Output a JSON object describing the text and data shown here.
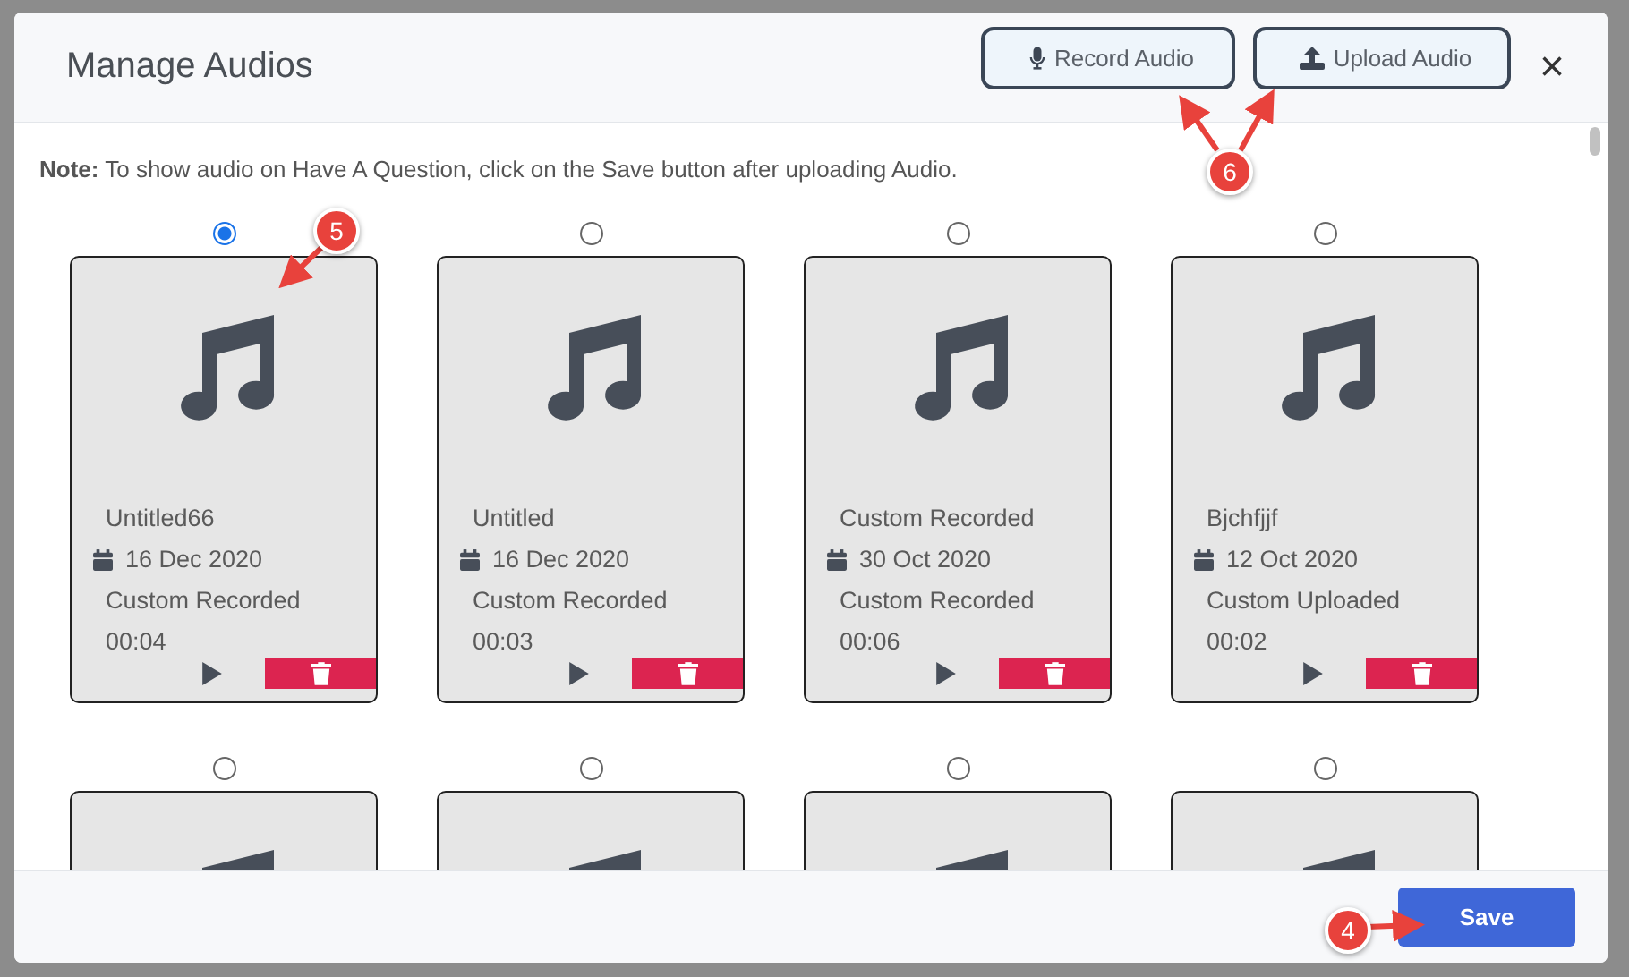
{
  "modal": {
    "title": "Manage Audios",
    "buttons": [
      {
        "kind": "record",
        "label": "Record Audio"
      },
      {
        "kind": "upload",
        "label": "Upload Audio"
      }
    ],
    "close": "×"
  },
  "note": {
    "label": "Note:",
    "text": "To show audio on Have A Question, click on the Save button after uploading Audio."
  },
  "cards": [
    {
      "selected": true,
      "name": "Untitled66",
      "date": "16 Dec 2020",
      "type": "Custom Recorded",
      "duration": "00:04"
    },
    {
      "selected": false,
      "name": "Untitled",
      "date": "16 Dec 2020",
      "type": "Custom Recorded",
      "duration": "00:03"
    },
    {
      "selected": false,
      "name": "Custom Recorded",
      "date": "30 Oct 2020",
      "type": "Custom Recorded",
      "duration": "00:06"
    },
    {
      "selected": false,
      "name": "Bjchfjjf",
      "date": "12 Oct 2020",
      "type": "Custom Uploaded",
      "duration": "00:02"
    },
    {
      "selected": false
    },
    {
      "selected": false
    },
    {
      "selected": false
    },
    {
      "selected": false
    }
  ],
  "footer": {
    "save": "Save"
  },
  "annotations": [
    {
      "label": "5"
    },
    {
      "label": "6"
    },
    {
      "label": "4"
    }
  ]
}
